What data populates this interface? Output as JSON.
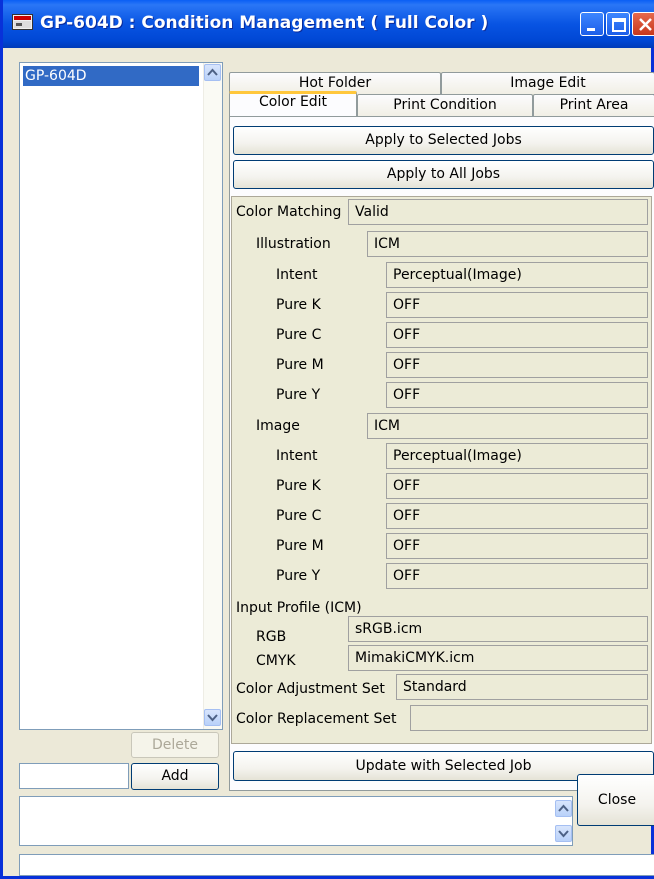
{
  "window": {
    "title": "GP-604D : Condition Management ( Full Color )"
  },
  "left": {
    "items": [
      "GP-604D"
    ],
    "delete_label": "Delete",
    "add_label": "Add",
    "new_name_value": ""
  },
  "tabs": {
    "top_row": [
      "Hot Folder",
      "Image Edit"
    ],
    "bottom_row": [
      "Color Edit",
      "Print Condition",
      "Print Area"
    ]
  },
  "actions": {
    "apply_selected": "Apply to Selected Jobs",
    "apply_all": "Apply to All Jobs",
    "update_selected": "Update with Selected Job"
  },
  "props": {
    "color_matching": {
      "label": "Color Matching",
      "value": "Valid"
    },
    "illustration": {
      "label": "Illustration",
      "value": "ICM",
      "intent": {
        "label": "Intent",
        "value": "Perceptual(Image)"
      },
      "pure_k": {
        "label": "Pure K",
        "value": "OFF"
      },
      "pure_c": {
        "label": "Pure C",
        "value": "OFF"
      },
      "pure_m": {
        "label": "Pure M",
        "value": "OFF"
      },
      "pure_y": {
        "label": "Pure Y",
        "value": "OFF"
      }
    },
    "image": {
      "label": "Image",
      "value": "ICM",
      "intent": {
        "label": "Intent",
        "value": "Perceptual(Image)"
      },
      "pure_k": {
        "label": "Pure K",
        "value": "OFF"
      },
      "pure_c": {
        "label": "Pure C",
        "value": "OFF"
      },
      "pure_m": {
        "label": "Pure M",
        "value": "OFF"
      },
      "pure_y": {
        "label": "Pure Y",
        "value": "OFF"
      }
    },
    "input_profile": {
      "label": "Input Profile (ICM)",
      "rgb": {
        "label": "RGB",
        "value": "sRGB.icm"
      },
      "cmyk": {
        "label": "CMYK",
        "value": "MimakiCMYK.icm"
      }
    },
    "color_adjustment_set": {
      "label": "Color Adjustment Set",
      "value": "Standard"
    },
    "color_replacement_set": {
      "label": "Color Replacement Set",
      "value": ""
    }
  },
  "bottom": {
    "message": "",
    "close_label": "Close",
    "status": ""
  },
  "colors": {
    "titlebar": "#0054e3",
    "selection": "#316ac5",
    "tab_highlight": "#ffc73c",
    "face": "#ece9d8"
  }
}
